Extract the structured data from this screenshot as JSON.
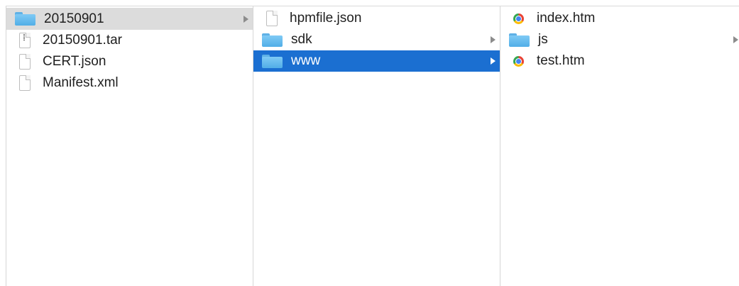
{
  "columns": [
    {
      "items": [
        {
          "name": "20150901",
          "kind": "folder",
          "state": "selected-inactive",
          "has_children": true
        },
        {
          "name": "20150901.tar",
          "kind": "archive"
        },
        {
          "name": "CERT.json",
          "kind": "file"
        },
        {
          "name": "Manifest.xml",
          "kind": "file"
        }
      ]
    },
    {
      "items": [
        {
          "name": "hpmfile.json",
          "kind": "file"
        },
        {
          "name": "sdk",
          "kind": "folder",
          "has_children": true
        },
        {
          "name": "www",
          "kind": "folder",
          "state": "selected-active",
          "has_children": true
        }
      ]
    },
    {
      "items": [
        {
          "name": "index.htm",
          "kind": "html-file"
        },
        {
          "name": "js",
          "kind": "folder",
          "has_children": true
        },
        {
          "name": "test.htm",
          "kind": "html-file"
        }
      ]
    }
  ],
  "colors": {
    "selection_active": "#1b6fd1",
    "selection_inactive": "#dcdcdc",
    "folder": "#5fb1e6",
    "divider": "#d6d6d6"
  },
  "icons": {
    "folder": "folder-icon",
    "file": "document-icon",
    "archive": "archive-icon",
    "html-file": "chrome-html-icon",
    "disclosure": "chevron-right-icon"
  }
}
